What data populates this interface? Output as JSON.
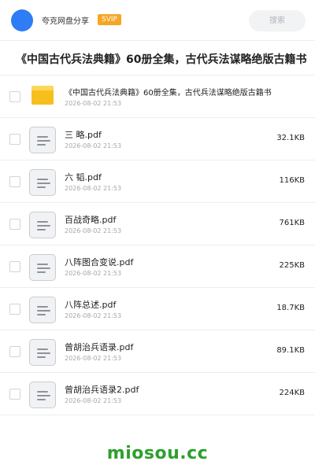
{
  "header": {
    "user_name": "夸克网盘分享",
    "badge": "SVIP",
    "search_placeholder": "搜索"
  },
  "page_title": "《中国古代兵法典籍》60册全集，古代兵法谋略绝版古籍书",
  "files": [
    {
      "name": "《中国古代兵法典籍》60册全集，古代兵法谋略绝版古籍书",
      "date": "2026-08-02 21:53",
      "size": "",
      "type": "folder"
    },
    {
      "name": "三 略.pdf",
      "date": "2026-08-02 21:53",
      "size": "32.1KB",
      "type": "pdf"
    },
    {
      "name": "六 韬.pdf",
      "date": "2026-08-02 21:53",
      "size": "116KB",
      "type": "pdf"
    },
    {
      "name": "百战奇略.pdf",
      "date": "2026-08-02 21:53",
      "size": "761KB",
      "type": "pdf"
    },
    {
      "name": "八阵图合变说.pdf",
      "date": "2026-08-02 21:53",
      "size": "225KB",
      "type": "pdf"
    },
    {
      "name": "八阵总述.pdf",
      "date": "2026-08-02 21:53",
      "size": "18.7KB",
      "type": "pdf"
    },
    {
      "name": "曾胡治兵语录.pdf",
      "date": "2026-08-02 21:53",
      "size": "89.1KB",
      "type": "pdf"
    },
    {
      "name": "曾胡治兵语录2.pdf",
      "date": "2026-08-02 21:53",
      "size": "224KB",
      "type": "pdf"
    }
  ],
  "watermark": "miosou.cc"
}
